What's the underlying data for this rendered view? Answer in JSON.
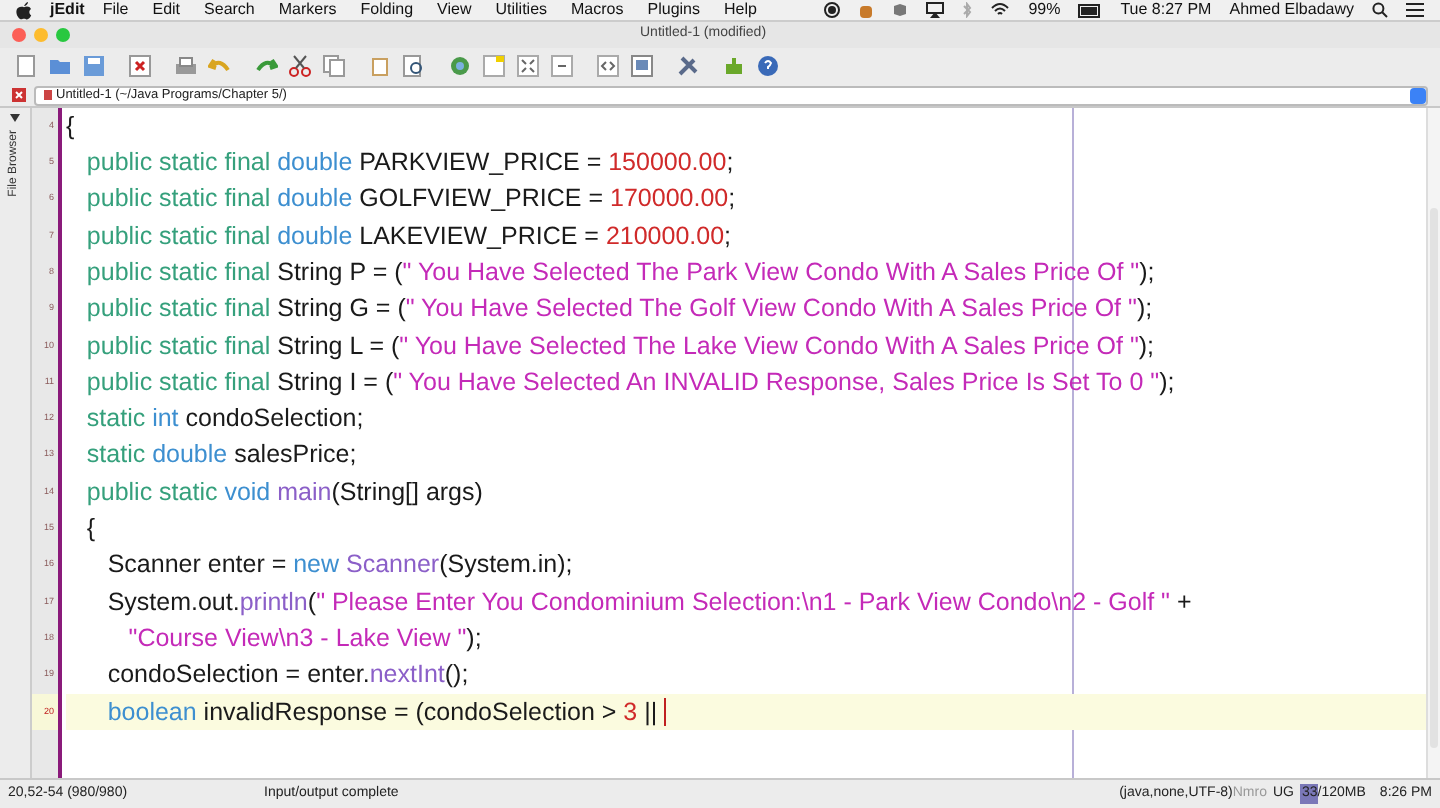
{
  "menubar": {
    "app": "jEdit",
    "items": [
      "File",
      "Edit",
      "Search",
      "Markers",
      "Folding",
      "View",
      "Utilities",
      "Macros",
      "Plugins",
      "Help"
    ],
    "battery": "99%",
    "clock": "Tue 8:27 PM",
    "user": "Ahmed Elbadawy"
  },
  "window": {
    "title": "Untitled-1 (modified)"
  },
  "buffer_switcher": {
    "value": "Untitled-1 (~/Java Programs/Chapter 5/)"
  },
  "dock_tab": {
    "label": "File Browser"
  },
  "editor": {
    "lines": [
      {
        "number": "4",
        "current": false,
        "tokens": [
          {
            "kind": "plain",
            "text": "{"
          }
        ]
      },
      {
        "number": "5",
        "current": false,
        "tokens": [
          {
            "kind": "keyword",
            "text": "   public static final "
          },
          {
            "kind": "type",
            "text": "double"
          },
          {
            "kind": "plain",
            "text": " PARKVIEW_PRICE = "
          },
          {
            "kind": "number",
            "text": "150000.00"
          },
          {
            "kind": "plain",
            "text": ";"
          }
        ]
      },
      {
        "number": "6",
        "current": false,
        "tokens": [
          {
            "kind": "keyword",
            "text": "   public static final "
          },
          {
            "kind": "type",
            "text": "double"
          },
          {
            "kind": "plain",
            "text": " GOLFVIEW_PRICE = "
          },
          {
            "kind": "number",
            "text": "170000.00"
          },
          {
            "kind": "plain",
            "text": ";"
          }
        ]
      },
      {
        "number": "7",
        "current": false,
        "tokens": [
          {
            "kind": "keyword",
            "text": "   public static final "
          },
          {
            "kind": "type",
            "text": "double"
          },
          {
            "kind": "plain",
            "text": " LAKEVIEW_PRICE = "
          },
          {
            "kind": "number",
            "text": "210000.00"
          },
          {
            "kind": "plain",
            "text": ";"
          }
        ]
      },
      {
        "number": "8",
        "current": false,
        "tokens": [
          {
            "kind": "keyword",
            "text": "   public static final "
          },
          {
            "kind": "plain",
            "text": "String P = ("
          },
          {
            "kind": "string",
            "text": "\" You Have Selected The Park View Condo With A Sales Price Of \""
          },
          {
            "kind": "plain",
            "text": ");"
          }
        ]
      },
      {
        "number": "9",
        "current": false,
        "tokens": [
          {
            "kind": "keyword",
            "text": "   public static final "
          },
          {
            "kind": "plain",
            "text": "String G = ("
          },
          {
            "kind": "string",
            "text": "\" You Have Selected The Golf View Condo With A Sales Price Of \""
          },
          {
            "kind": "plain",
            "text": ");"
          }
        ]
      },
      {
        "number": "10",
        "current": false,
        "tokens": [
          {
            "kind": "keyword",
            "text": "   public static final "
          },
          {
            "kind": "plain",
            "text": "String L = ("
          },
          {
            "kind": "string",
            "text": "\" You Have Selected The Lake View Condo With A Sales Price Of \""
          },
          {
            "kind": "plain",
            "text": ");"
          }
        ]
      },
      {
        "number": "11",
        "current": false,
        "tokens": [
          {
            "kind": "keyword",
            "text": "   public static final "
          },
          {
            "kind": "plain",
            "text": "String I = ("
          },
          {
            "kind": "string",
            "text": "\" You Have Selected An INVALID Response, Sales Price Is Set To 0 \""
          },
          {
            "kind": "plain",
            "text": ");"
          }
        ]
      },
      {
        "number": "12",
        "current": false,
        "tokens": [
          {
            "kind": "keyword",
            "text": "   static "
          },
          {
            "kind": "type",
            "text": "int"
          },
          {
            "kind": "plain",
            "text": " condoSelection;"
          }
        ]
      },
      {
        "number": "13",
        "current": false,
        "tokens": [
          {
            "kind": "keyword",
            "text": "   static "
          },
          {
            "kind": "type",
            "text": "double"
          },
          {
            "kind": "plain",
            "text": " salesPrice;"
          }
        ]
      },
      {
        "number": "14",
        "current": false,
        "tokens": [
          {
            "kind": "keyword",
            "text": "   public static "
          },
          {
            "kind": "type",
            "text": "void "
          },
          {
            "kind": "function",
            "text": "main"
          },
          {
            "kind": "plain",
            "text": "(String[] args)"
          }
        ]
      },
      {
        "number": "15",
        "current": false,
        "tokens": [
          {
            "kind": "plain",
            "text": "   {"
          }
        ]
      },
      {
        "number": "16",
        "current": false,
        "tokens": [
          {
            "kind": "plain",
            "text": "      Scanner enter = "
          },
          {
            "kind": "type",
            "text": "new "
          },
          {
            "kind": "function",
            "text": "Scanner"
          },
          {
            "kind": "plain",
            "text": "(System.in);"
          }
        ]
      },
      {
        "number": "17",
        "current": false,
        "tokens": [
          {
            "kind": "plain",
            "text": "      System.out."
          },
          {
            "kind": "function",
            "text": "println"
          },
          {
            "kind": "plain",
            "text": "("
          },
          {
            "kind": "string",
            "text": "\" Please Enter You Condominium Selection:\\n1 - Park View Condo\\n2 - Golf \""
          },
          {
            "kind": "plain",
            "text": " +"
          }
        ]
      },
      {
        "number": "18",
        "current": false,
        "tokens": [
          {
            "kind": "string",
            "text": "         \"Course View\\n3 - Lake View \""
          },
          {
            "kind": "plain",
            "text": ");"
          }
        ]
      },
      {
        "number": "19",
        "current": false,
        "tokens": [
          {
            "kind": "plain",
            "text": "      condoSelection = enter."
          },
          {
            "kind": "function",
            "text": "nextInt"
          },
          {
            "kind": "plain",
            "text": "();"
          }
        ]
      },
      {
        "number": "20",
        "current": true,
        "tokens": [
          {
            "kind": "type",
            "text": "      boolean"
          },
          {
            "kind": "plain",
            "text": " invalidResponse = (condoSelection > "
          },
          {
            "kind": "number",
            "text": "3"
          },
          {
            "kind": "plain",
            "text": " ||"
          }
        ]
      }
    ]
  },
  "status_bar": {
    "position": "20,52-54 (980/980)",
    "message": "Input/output complete",
    "mode": "(java,none,UTF-8)",
    "flags": "Nmro",
    "encoding_flags": "UG",
    "memory": "33/120MB",
    "memory_level": {
      "level": 0.28
    },
    "time": "8:26 PM"
  }
}
